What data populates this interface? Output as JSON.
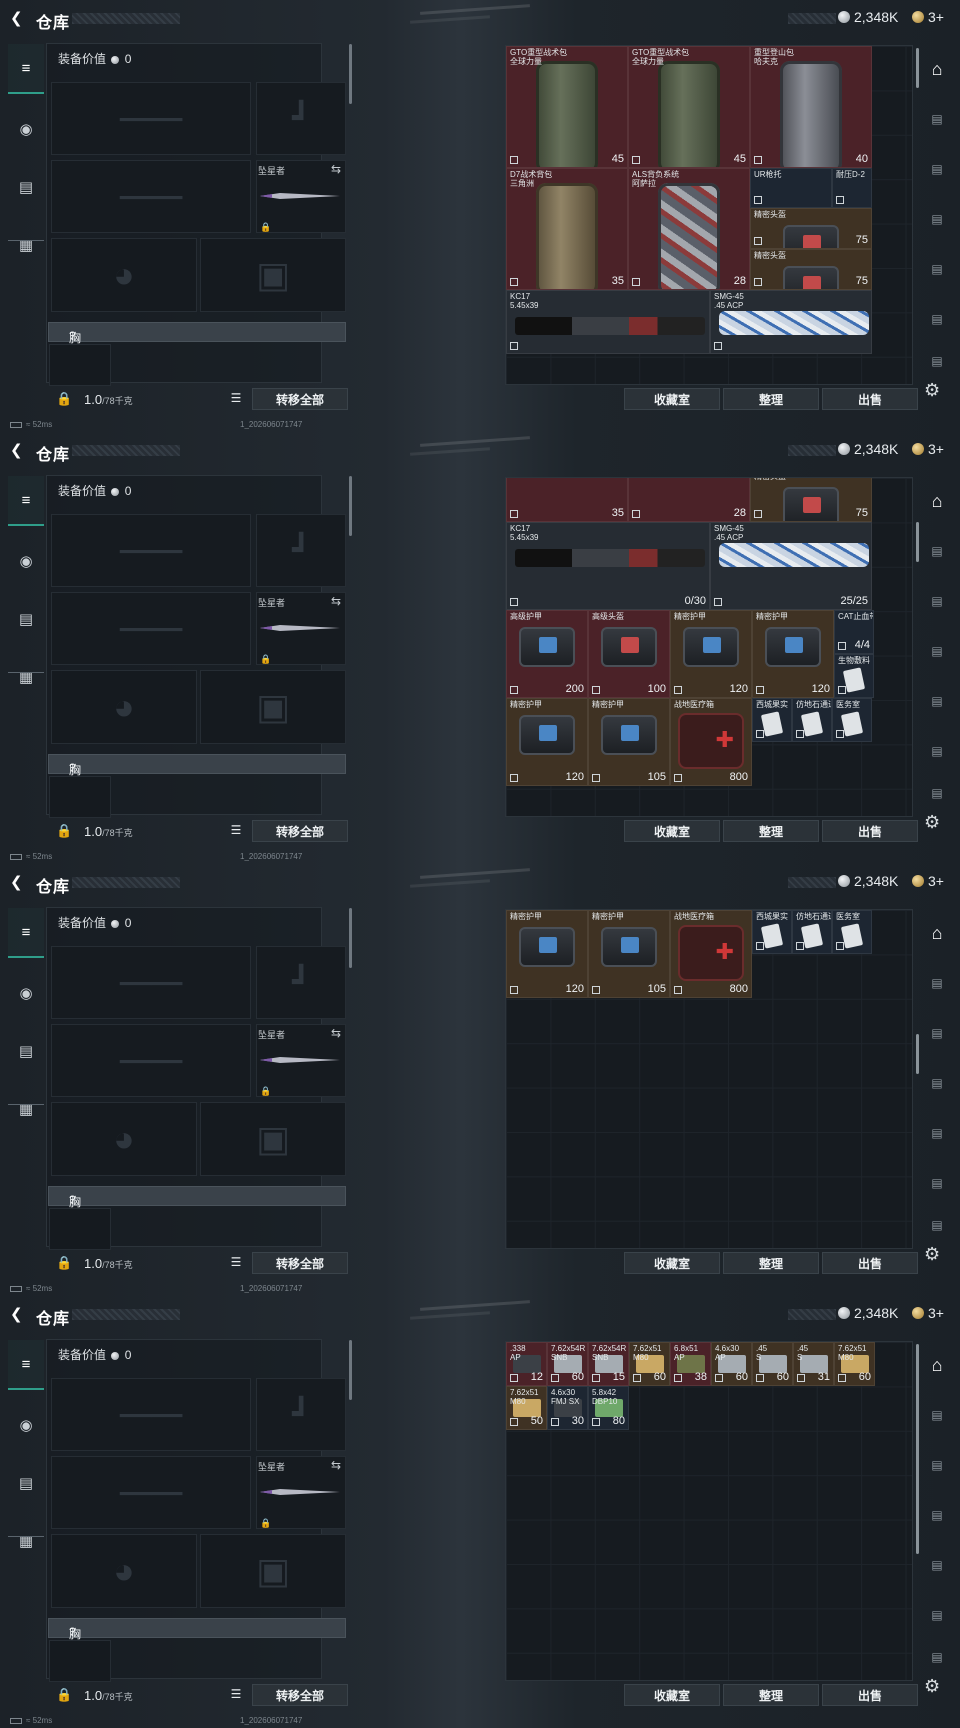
{
  "header": {
    "title": "仓库",
    "back_icon": "back-arrow-icon",
    "currency_amount": "2,348K",
    "gold_amount": "3+"
  },
  "loadout": {
    "equipment_value_label": "装备价值",
    "equipment_value": "0",
    "melee_name": "坠星者",
    "chest_rig_label": "胸挂",
    "chest_rig_hint": "?",
    "weight_current": "1.0",
    "weight_max": "/78千克",
    "transfer_all": "转移全部"
  },
  "actions": {
    "collection": "收藏室",
    "organize": "整理",
    "sell": "出售"
  },
  "status": {
    "ping": "52ms",
    "uid": "1_202606071747"
  },
  "panels": [
    {
      "items": [
        {
          "name": "GTO重型战术包\n全球力量",
          "value": "45"
        },
        {
          "name": "GTO重型战术包\n全球力量",
          "value": "45"
        },
        {
          "name": "重型登山包\n哈夫克",
          "value": "40"
        },
        {
          "name": "D7战术背包\n三角洲",
          "value": "35"
        },
        {
          "name": "ALS背负系统\n阿萨拉",
          "value": "28"
        },
        {
          "name": "UR枪托",
          "value": ""
        },
        {
          "name": "耐压D-2",
          "value": ""
        },
        {
          "name": "精密头盔",
          "value": "75"
        },
        {
          "name": "精密头盔",
          "value": "75"
        },
        {
          "name": "KC17\n5.45x39",
          "value": ""
        },
        {
          "name": "SMG-45\n.45 ACP",
          "value": ""
        }
      ]
    },
    {
      "items": [
        {
          "name": "",
          "value": "35"
        },
        {
          "name": "",
          "value": "28"
        },
        {
          "name": "精密头盔",
          "value": "75"
        },
        {
          "name": "KC17\n5.45x39",
          "value": "0/30"
        },
        {
          "name": "SMG-45\n.45 ACP",
          "value": "25/25"
        },
        {
          "name": "高级护甲",
          "value": "200"
        },
        {
          "name": "高级头盔",
          "value": "100"
        },
        {
          "name": "精密护甲",
          "value": "120"
        },
        {
          "name": "精密护甲",
          "value": "120"
        },
        {
          "name": "CAT止血带",
          "value": "4/4"
        },
        {
          "name": "生物敷料",
          "value": ""
        },
        {
          "name": "精密护甲",
          "value": "120"
        },
        {
          "name": "精密护甲",
          "value": "105"
        },
        {
          "name": "战地医疗箱",
          "value": "800"
        },
        {
          "name": "西城果实",
          "value": ""
        },
        {
          "name": "仿地石通道",
          "value": ""
        },
        {
          "name": "医务室",
          "value": ""
        }
      ]
    },
    {
      "items": [
        {
          "name": "精密护甲",
          "value": "120"
        },
        {
          "name": "精密护甲",
          "value": "105"
        },
        {
          "name": "战地医疗箱",
          "value": "800"
        },
        {
          "name": "西城果实",
          "value": ""
        },
        {
          "name": "仿地石通道",
          "value": ""
        },
        {
          "name": "医务室",
          "value": ""
        }
      ]
    },
    {
      "items": [
        {
          "name": ".338\nAP",
          "value": "12"
        },
        {
          "name": "7.62x54R\nSNB",
          "value": "60"
        },
        {
          "name": "7.62x54R\nSNB",
          "value": "15"
        },
        {
          "name": "7.62x51\nM80",
          "value": "60"
        },
        {
          "name": "6.8x51\nAP",
          "value": "38"
        },
        {
          "name": "4.6x30\nAP",
          "value": "60"
        },
        {
          "name": ".45\nS",
          "value": "60"
        },
        {
          "name": ".45\nS",
          "value": "31"
        },
        {
          "name": "7.62x51\nM80",
          "value": "60"
        },
        {
          "name": "7.62x51\nM80",
          "value": "50"
        },
        {
          "name": "4.6x30\nFMJ SX",
          "value": "30"
        },
        {
          "name": "5.8x42\nDBP10",
          "value": "80"
        }
      ]
    }
  ]
}
